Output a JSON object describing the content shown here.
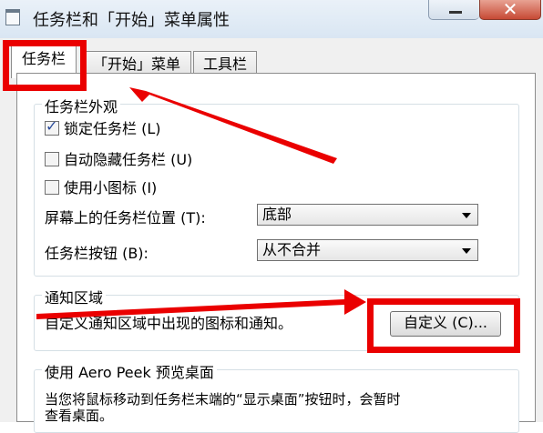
{
  "window": {
    "title": "任务栏和「开始」菜单属性"
  },
  "tabs": [
    {
      "label": "任务栏",
      "active": true
    },
    {
      "label": "「开始」菜单",
      "active": false
    },
    {
      "label": "工具栏",
      "active": false
    }
  ],
  "appearance": {
    "legend": "任务栏外观",
    "lock_label": "锁定任务栏 (L)",
    "lock_checked": true,
    "autohide_label": "自动隐藏任务栏 (U)",
    "autohide_checked": false,
    "small_icons_label": "使用小图标 (I)",
    "small_icons_checked": false,
    "location_label": "屏幕上的任务栏位置 (T):",
    "location_value": "底部",
    "buttons_label": "任务栏按钮 (B):",
    "buttons_value": "从不合并"
  },
  "notification": {
    "legend": "通知区域",
    "description": "自定义通知区域中出现的图标和通知。",
    "customize_button": "自定义 (C)..."
  },
  "aero_peek": {
    "legend": "使用 Aero Peek 预览桌面",
    "description_line1": "当您将鼠标移动到任务栏末端的“显示桌面”按钮时，会暂时",
    "description_line2": "查看桌面。"
  },
  "annotation_color": "#ea0000"
}
